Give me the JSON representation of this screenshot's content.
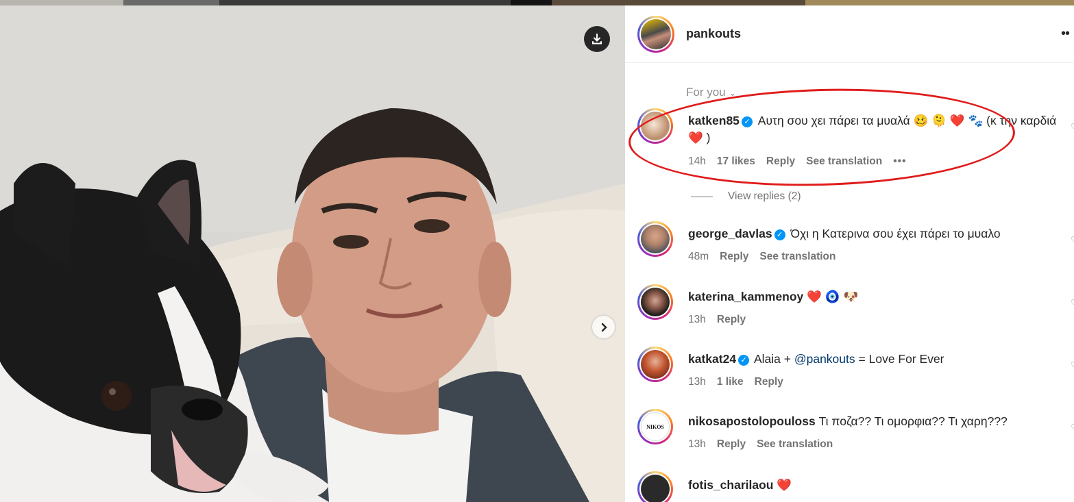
{
  "post": {
    "author": "pankouts",
    "more_icon": "more-horizontal-icon"
  },
  "comments_filter": {
    "label": "For you",
    "icon": "chevron-down-icon"
  },
  "comments": [
    {
      "username": "katken85",
      "verified": true,
      "text_before": "Αυτη σου χει πάρει τα μυαλά 🥴 🫠 ❤️ 🐾 (κ την καρδιά",
      "heart": "❤️",
      "text_after": ")",
      "time": "14h",
      "likes": "17 likes",
      "reply": "Reply",
      "translate": "See translation",
      "dots": "•••",
      "view_replies": "View replies (2)"
    },
    {
      "username": "george_davlas",
      "verified": true,
      "text": "Όχι η Κατερινα σου έχει πάρει το μυαλο",
      "time": "48m",
      "reply": "Reply",
      "translate": "See translation"
    },
    {
      "username": "katerina_kammenoy",
      "verified": false,
      "text": "❤️ 🧿 🐶",
      "time": "13h",
      "reply": "Reply"
    },
    {
      "username": "katkat24",
      "verified": true,
      "text_before": "Alaia +",
      "mention": "@pankouts",
      "text_after": "= Love For Ever",
      "time": "13h",
      "likes": "1 like",
      "reply": "Reply"
    },
    {
      "username": "nikosapostolopouloss",
      "verified": false,
      "text": "Τι ποζα?? Τι ομορφια?? Τι χαρη???",
      "time": "13h",
      "reply": "Reply",
      "translate": "See translation",
      "avatar_text": "NIKOS"
    },
    {
      "username": "fotis_charilaou",
      "verified": false,
      "text": "❤️"
    }
  ],
  "icons": {
    "download": "download-icon",
    "next": "chevron-right-icon",
    "verified": "verified-badge-icon",
    "heart": "heart-icon"
  },
  "verified_glyph": "✓",
  "heart_glyph": "♡",
  "annotation": {
    "color": "#e01b1b"
  }
}
